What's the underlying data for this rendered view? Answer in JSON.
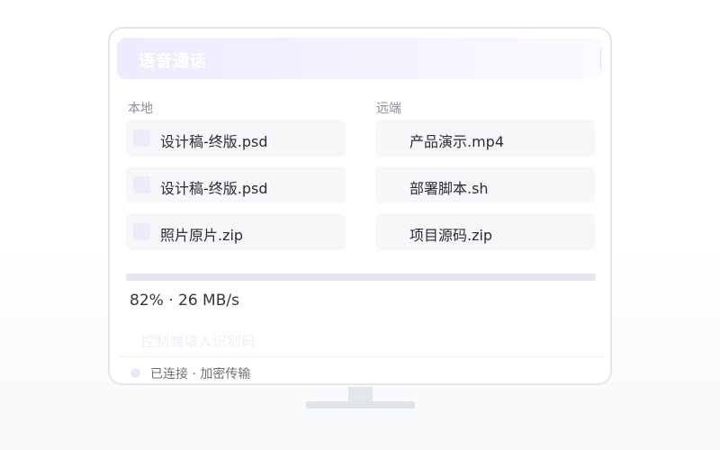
{
  "header": {
    "title": "语音通话"
  },
  "local": {
    "label": "本地",
    "files": [
      {
        "name": "设计稿-终版.psd"
      },
      {
        "name": "设计稿-终版.psd"
      },
      {
        "name": "照片原片.zip"
      }
    ]
  },
  "remote": {
    "label": "远端",
    "files": [
      {
        "name": "产品演示.mp4"
      },
      {
        "name": "部署脚本.sh"
      },
      {
        "name": "项目源码.zip"
      }
    ]
  },
  "transfer": {
    "progress_percent": 82,
    "status_text": "82% · 26 MB/s"
  },
  "hint": {
    "text": "控制端填入识别码"
  },
  "connection": {
    "text": "已连接 · 加密传输"
  },
  "colors": {
    "accent_light": "#efeaff",
    "file_bg": "#f6f7f9",
    "track": "#e4e8ed"
  }
}
